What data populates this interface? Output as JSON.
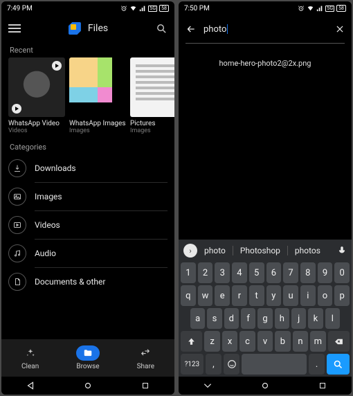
{
  "left": {
    "status": {
      "time": "7:49 PM"
    },
    "app": {
      "title": "Files"
    },
    "recent": {
      "header": "Recent",
      "items": [
        {
          "label": "WhatsApp Video",
          "sub": "Videos"
        },
        {
          "label": "WhatsApp Images",
          "sub": "Images"
        },
        {
          "label": "Pictures",
          "sub": "Images"
        }
      ]
    },
    "categories": {
      "header": "Categories",
      "items": [
        {
          "name": "Downloads"
        },
        {
          "name": "Images"
        },
        {
          "name": "Videos"
        },
        {
          "name": "Audio"
        },
        {
          "name": "Documents & other"
        }
      ]
    },
    "nav": {
      "clean": "Clean",
      "browse": "Browse",
      "share": "Share"
    }
  },
  "right": {
    "status": {
      "time": "7:50 PM"
    },
    "search": {
      "query": "photo"
    },
    "result": "home-hero-photo2@2x.png",
    "suggestions": [
      "photo",
      "Photoshop",
      "photos"
    ],
    "keyboard": {
      "row_num": [
        "1",
        "2",
        "3",
        "4",
        "5",
        "6",
        "7",
        "8",
        "9",
        "0"
      ],
      "row1": [
        "q",
        "w",
        "e",
        "r",
        "t",
        "y",
        "u",
        "i",
        "o",
        "p"
      ],
      "row2": [
        "a",
        "s",
        "d",
        "f",
        "g",
        "h",
        "j",
        "k",
        "l"
      ],
      "row3": [
        "z",
        "x",
        "c",
        "v",
        "b",
        "n",
        "m"
      ],
      "sym": "?123",
      "comma": ",",
      "period": "."
    }
  }
}
